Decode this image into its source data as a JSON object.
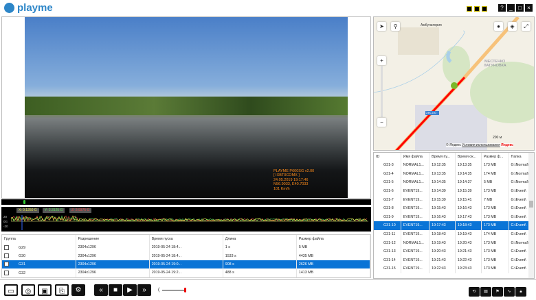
{
  "app": {
    "name": "playme",
    "brand_color": "#2d86c8"
  },
  "window": {
    "help": "?",
    "minimize": "_",
    "maximize": "□",
    "close": "×"
  },
  "video": {
    "osd": [
      "PLAYME P600SG v2.00",
      "[ IXBT0COMX ]",
      "24.05.2019 19:17:46",
      "N56.9033, E40.7033",
      "101 Km/h"
    ],
    "osd_color": "#ff8c1a"
  },
  "gsensor": {
    "x": "X: 0.1250 G",
    "y": "Y: 2.3125 G",
    "z": "Z: 2.9375 G",
    "axis": [
      "20",
      "0G",
      "-20"
    ]
  },
  "groups": {
    "columns": [
      "Группа",
      "Разрешение",
      "Время пуска",
      "Длина",
      "Размер файла"
    ],
    "rows": [
      [
        "G29",
        "2304x1296",
        "2019-05-24 18:4...",
        "1 s",
        "5 MB"
      ],
      [
        "G30",
        "2304x1296",
        "2019-05-24 18:4...",
        "1533 s",
        "4435 MB"
      ],
      [
        "G31",
        "2304x1296",
        "2019-05-24 19:0...",
        "908 s",
        "2626 MB"
      ],
      [
        "G32",
        "2304x1296",
        "2019-05-24 19:2...",
        "488 s",
        "1413 MB"
      ]
    ],
    "selected": 2
  },
  "map": {
    "poi": "Амбулатория",
    "area": [
      "МЕСТЕЧКО",
      "ЛАТУНОВКА"
    ],
    "road": "24К-140",
    "scale": "200 м",
    "copyright": "© Яндекс",
    "terms": "Условия использования",
    "yandex": "Яндекс",
    "zoom_in": "+",
    "zoom_out": "−"
  },
  "files": {
    "columns": [
      "ID",
      "Имя файла",
      "Время пу...",
      "Время ок...",
      "Размер ф...",
      "Папка"
    ],
    "rows": [
      [
        "G31-3",
        "NORMAL1...",
        "19:12:35",
        "19:13:35",
        "173 MB",
        "G:\\Normal\\"
      ],
      [
        "G31-4",
        "NORMAL1...",
        "19:13:35",
        "19:14:35",
        "174 MB",
        "G:\\Normal\\"
      ],
      [
        "G31-5",
        "NORMAL1...",
        "19:14:35",
        "19:14:37",
        "5 MB",
        "G:\\Normal\\"
      ],
      [
        "G31-6",
        "EVENT19...",
        "19:14:39",
        "19:15:39",
        "173 MB",
        "G:\\Event\\"
      ],
      [
        "G31-7",
        "EVENT19...",
        "19:15:39",
        "19:15:41",
        "7 MB",
        "G:\\Event\\"
      ],
      [
        "G31-8",
        "EVENT19...",
        "19:15:43",
        "19:16:43",
        "173 MB",
        "G:\\Event\\"
      ],
      [
        "G31-9",
        "EVENT19...",
        "19:16:43",
        "19:17:43",
        "173 MB",
        "G:\\Event\\"
      ],
      [
        "G31-10",
        "EVENT19...",
        "19:17:43",
        "19:18:43",
        "173 MB",
        "G:\\Event\\"
      ],
      [
        "G31-11",
        "EVENT19...",
        "19:18:43",
        "19:19:43",
        "174 MB",
        "G:\\Event\\"
      ],
      [
        "G31-12",
        "NORMAL1...",
        "19:19:43",
        "19:20:43",
        "173 MB",
        "G:\\Normal\\"
      ],
      [
        "G31-13",
        "EVENT19...",
        "19:20:43",
        "19:21:43",
        "173 MB",
        "G:\\Event\\"
      ],
      [
        "G31-14",
        "EVENT19...",
        "19:21:43",
        "19:22:43",
        "173 MB",
        "G:\\Event\\"
      ],
      [
        "G31-15",
        "EVENT19...",
        "19:22:43",
        "19:23:43",
        "173 MB",
        "G:\\Event\\"
      ]
    ],
    "selected": 7
  },
  "playback": {
    "volume": 1.0
  },
  "selection_color": "#0a74d6"
}
